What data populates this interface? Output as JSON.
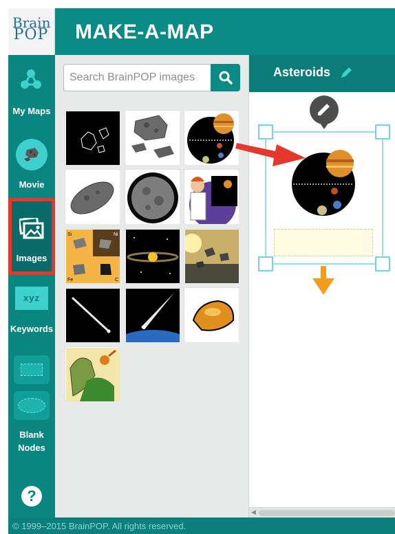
{
  "app": {
    "logo_line1": "Brain",
    "logo_line2": "POP",
    "title": "MAKE-A-MAP"
  },
  "sidebar": {
    "items": [
      {
        "label": "My Maps",
        "icon": "network-icon"
      },
      {
        "label": "Movie",
        "icon": "asteroid-icon"
      },
      {
        "label": "Images",
        "icon": "images-icon",
        "selected": true
      },
      {
        "label": "Keywords",
        "icon": "keywords-icon",
        "box_text": "xyz"
      },
      {
        "label_line1": "Blank",
        "label_line2": "Nodes",
        "icons": [
          "rectangle-node-icon",
          "oval-node-icon"
        ]
      }
    ],
    "help_label": "?"
  },
  "search": {
    "placeholder": "Search BrainPOP images",
    "value": ""
  },
  "image_grid": {
    "items": [
      "asteroid-outlines-image",
      "gray-asteroids-image",
      "solar-system-image",
      "single-asteroid-image",
      "cratered-moon-image",
      "scientist-telescope-image",
      "minerals-chart-image",
      "asteroid-belt-image",
      "asteroid-field-image",
      "meteor-streak-image",
      "comet-over-earth-image",
      "orange-asteroid-image",
      "dinosaur-meteor-image"
    ],
    "minerals_labels": [
      "Si",
      "Ni",
      "Fe",
      "C"
    ]
  },
  "map": {
    "title": "Asteroids",
    "node_image": "solar-system-image",
    "node_caption": ""
  },
  "colors": {
    "brand_teal": "#0c8a86",
    "selection_red": "#e6372d",
    "arrow_orange": "#f39c1e",
    "selection_cyan": "#6fd6e6"
  },
  "footer": {
    "copyright": "© 1999–2015 BrainPOP. All rights reserved."
  }
}
